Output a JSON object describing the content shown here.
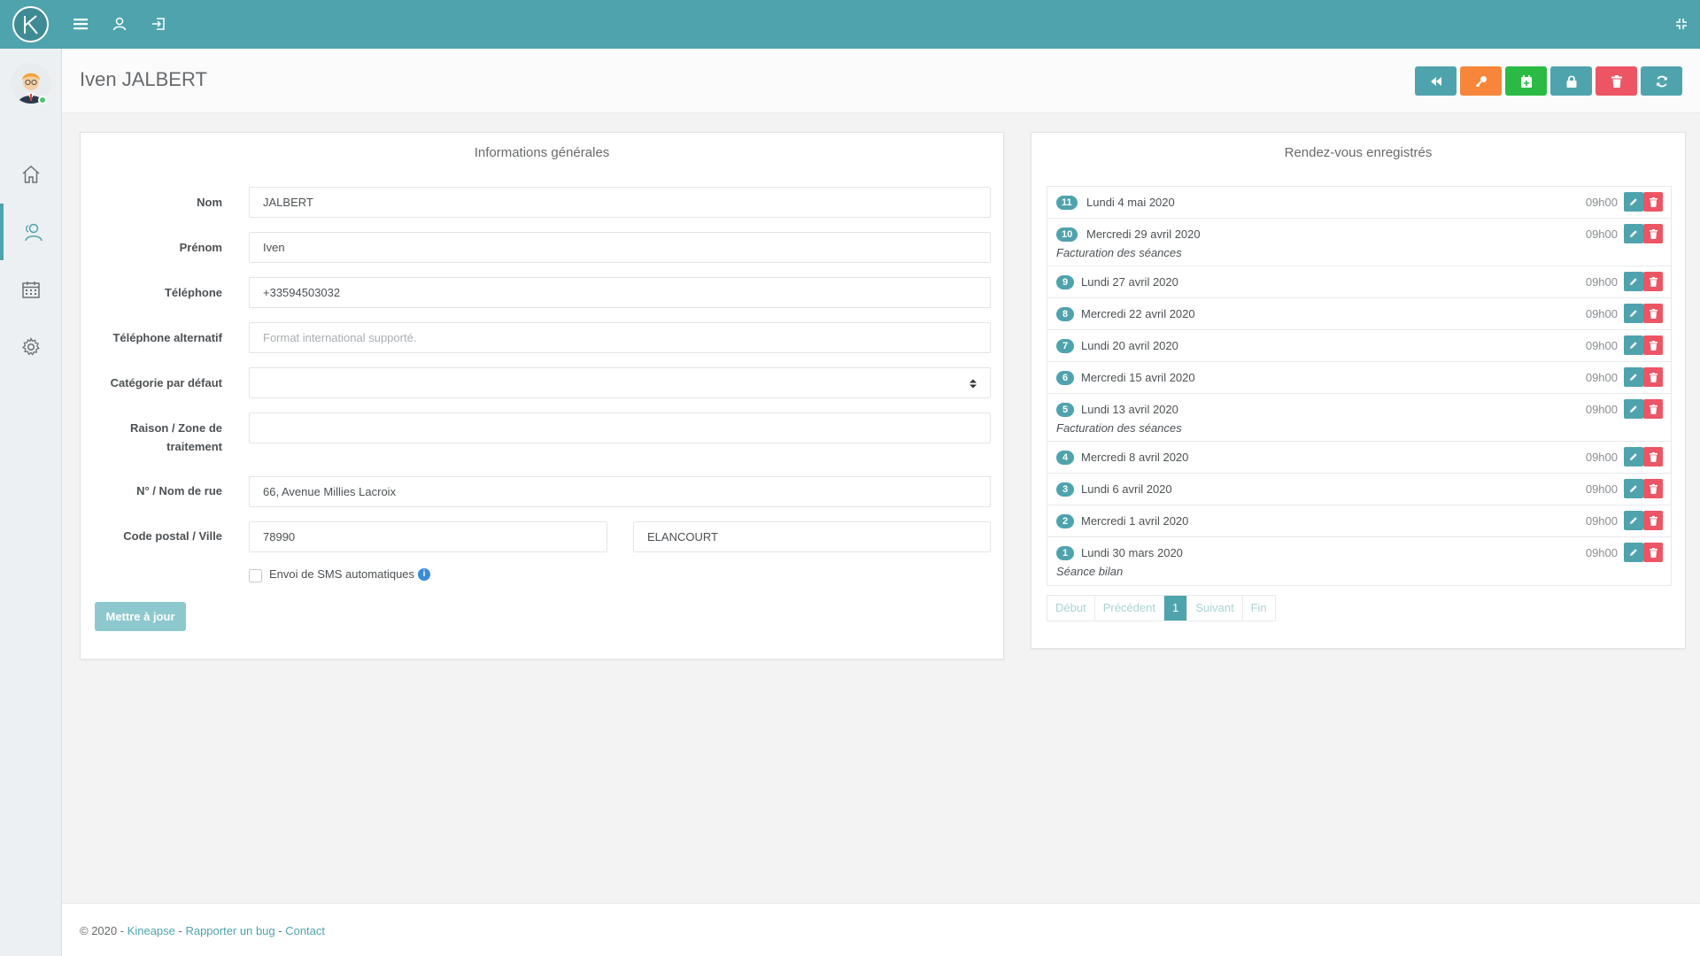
{
  "app": {
    "logo_letter": "K"
  },
  "page": {
    "title": "Iven JALBERT"
  },
  "colors": {
    "primary": "#4fa3ad",
    "orange": "#f7853a",
    "green": "#2bbb45",
    "red": "#ed5565"
  },
  "form": {
    "title": "Informations générales",
    "fields": {
      "nom": {
        "label": "Nom",
        "value": "JALBERT"
      },
      "prenom": {
        "label": "Prénom",
        "value": "Iven"
      },
      "telephone": {
        "label": "Téléphone",
        "value": "+33594503032"
      },
      "telephone_alt": {
        "label": "Téléphone alternatif",
        "placeholder": "Format international supporté."
      },
      "categorie": {
        "label": "Catégorie par défaut",
        "value": ""
      },
      "raison": {
        "label_line1": "Raison / Zone de",
        "label_line2": "traitement",
        "value": ""
      },
      "rue": {
        "label": "N° / Nom de rue",
        "value": "66, Avenue Millies Lacroix"
      },
      "cp_ville": {
        "label": "Code postal / Ville",
        "cp": "78990",
        "ville": "ELANCOURT"
      }
    },
    "sms_label": "Envoi de SMS automatiques",
    "update_label": "Mettre à jour"
  },
  "appointments": {
    "title": "Rendez-vous enregistrés",
    "items": [
      {
        "num": "11",
        "date": "Lundi 4 mai 2020",
        "time": "09h00",
        "note": ""
      },
      {
        "num": "10",
        "date": "Mercredi 29 avril 2020",
        "time": "09h00",
        "note": "Facturation des séances"
      },
      {
        "num": "9",
        "date": "Lundi 27 avril 2020",
        "time": "09h00",
        "note": ""
      },
      {
        "num": "8",
        "date": "Mercredi 22 avril 2020",
        "time": "09h00",
        "note": ""
      },
      {
        "num": "7",
        "date": "Lundi 20 avril 2020",
        "time": "09h00",
        "note": ""
      },
      {
        "num": "6",
        "date": "Mercredi 15 avril 2020",
        "time": "09h00",
        "note": ""
      },
      {
        "num": "5",
        "date": "Lundi 13 avril 2020",
        "time": "09h00",
        "note": "Facturation des séances"
      },
      {
        "num": "4",
        "date": "Mercredi 8 avril 2020",
        "time": "09h00",
        "note": ""
      },
      {
        "num": "3",
        "date": "Lundi 6 avril 2020",
        "time": "09h00",
        "note": ""
      },
      {
        "num": "2",
        "date": "Mercredi 1 avril 2020",
        "time": "09h00",
        "note": ""
      },
      {
        "num": "1",
        "date": "Lundi 30 mars 2020",
        "time": "09h00",
        "note": "Séance bilan"
      }
    ],
    "pager": {
      "first": "Début",
      "prev": "Précédent",
      "current": "1",
      "next": "Suivant",
      "last": "Fin"
    }
  },
  "footer": {
    "prefix": "© 2020 - ",
    "kineapse": "Kineapse",
    "sep1": " - ",
    "bug": "Rapporter un bug",
    "sep2": " - ",
    "contact": "Contact"
  }
}
